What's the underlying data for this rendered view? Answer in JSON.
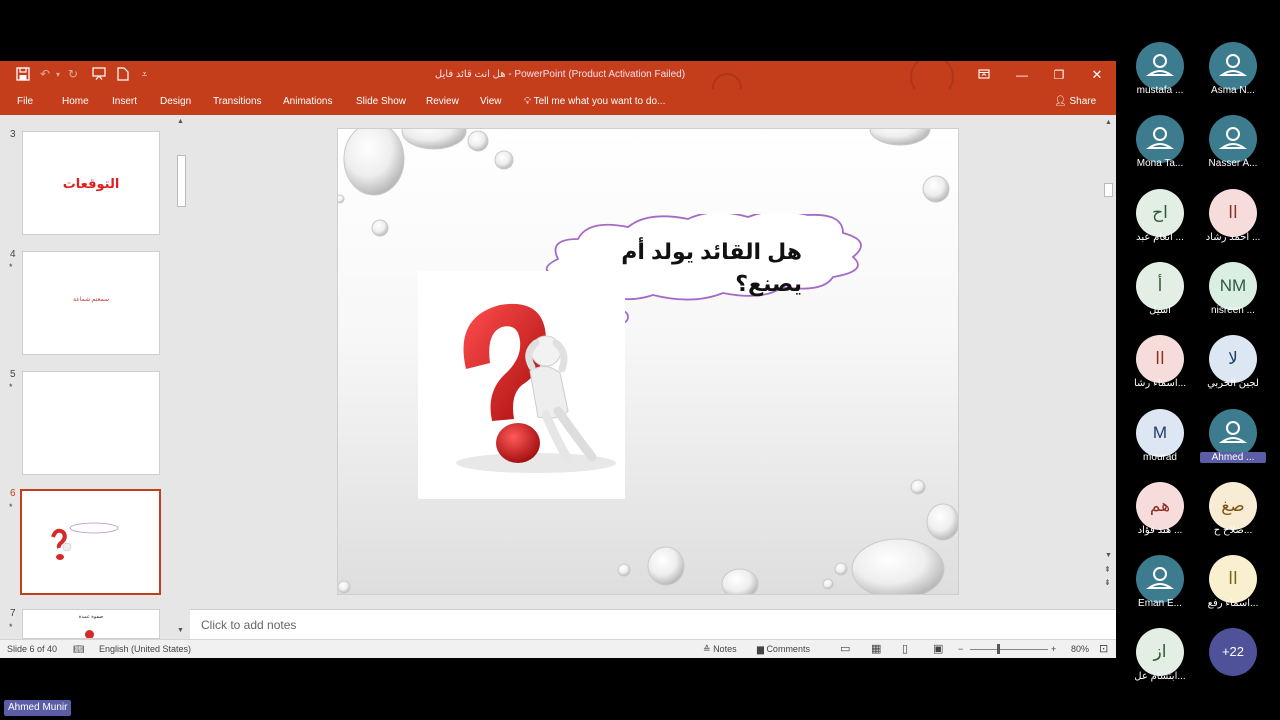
{
  "window": {
    "title": "هل انت قائد فايل - PowerPoint (Product Activation Failed)"
  },
  "ribbon": {
    "tabs": [
      "File",
      "Home",
      "Insert",
      "Design",
      "Transitions",
      "Animations",
      "Slide Show",
      "Review",
      "View"
    ],
    "tell_me": "Tell me what you want to do...",
    "share": "Share"
  },
  "thumbnails": [
    {
      "num": "3",
      "star": "",
      "text": "التوقعات"
    },
    {
      "num": "4",
      "star": "*",
      "text": "سمعتم شماعة"
    },
    {
      "num": "5",
      "star": "*",
      "text": ""
    },
    {
      "num": "6",
      "star": "*",
      "text": ""
    },
    {
      "num": "7",
      "star": "*",
      "text": "صفوة عمدة"
    }
  ],
  "slide": {
    "bubble_line1": "هل القائد يولد أم",
    "bubble_line2": "يصنع؟"
  },
  "notes_placeholder": "Click to add notes",
  "status": {
    "slide_info": "Slide 6 of 40",
    "language": "English (United States)",
    "notes": "Notes",
    "comments": "Comments",
    "zoom": "80%"
  },
  "participants": [
    {
      "initials": "",
      "name": "mustafa ...",
      "bg": "#3d7c8e",
      "fg": "#ffffff",
      "type": "person"
    },
    {
      "initials": "",
      "name": "Asma N...",
      "bg": "#3d7c8e",
      "fg": "#ffffff",
      "type": "person"
    },
    {
      "initials": "",
      "name": "Mona Ta...",
      "bg": "#3d7c8e",
      "fg": "#ffffff",
      "type": "person"
    },
    {
      "initials": "",
      "name": "Nasser A...",
      "bg": "#3d7c8e",
      "fg": "#ffffff",
      "type": "person"
    },
    {
      "initials": "اح",
      "name": "انعام عبد ...",
      "bg": "#e3efe4",
      "fg": "#2e5a32",
      "type": "initials"
    },
    {
      "initials": "اا",
      "name": "احمد رشاد ...",
      "bg": "#f6dddb",
      "fg": "#8f2f24",
      "type": "initials"
    },
    {
      "initials": "أ",
      "name": "اسيل",
      "bg": "#e3efe4",
      "fg": "#2e5a32",
      "type": "initials"
    },
    {
      "initials": "NM",
      "name": "nisreen ...",
      "bg": "#dbeee2",
      "fg": "#2b5b3d",
      "type": "initials"
    },
    {
      "initials": "اا",
      "name": "اسماء رشا...",
      "bg": "#f6dddb",
      "fg": "#8f2f24",
      "type": "initials"
    },
    {
      "initials": "لا",
      "name": "لجين الحربي",
      "bg": "#dde6f3",
      "fg": "#1f3d6b",
      "type": "initials"
    },
    {
      "initials": "M",
      "name": "mourad",
      "bg": "#dde6f3",
      "fg": "#1f3d6b",
      "type": "initials"
    },
    {
      "initials": "",
      "name": "Ahmed ...",
      "bg": "#3d7c8e",
      "fg": "#ffffff",
      "type": "person"
    },
    {
      "initials": "هم",
      "name": "هند فؤاد ...",
      "bg": "#f6dddb",
      "fg": "#8f2f24",
      "type": "initials"
    },
    {
      "initials": "صغ",
      "name": "صلاح ح...",
      "bg": "#f8ecd4",
      "fg": "#7a5614",
      "type": "initials"
    },
    {
      "initials": "",
      "name": "Eman E...",
      "bg": "#3d7c8e",
      "fg": "#ffffff",
      "type": "person"
    },
    {
      "initials": "اا",
      "name": "اسماء رفع...",
      "bg": "#f8f0cf",
      "fg": "#7a5f0f",
      "type": "initials"
    },
    {
      "initials": "از",
      "name": "ابتسام عل...",
      "bg": "#e3efe4",
      "fg": "#2e5a32",
      "type": "initials"
    },
    {
      "initials": "+22",
      "name": "",
      "bg": "#4f5199",
      "fg": "#ffffff",
      "type": "more"
    }
  ],
  "presenter_label": "Ahmed Munir",
  "colors": {
    "ppt_accent": "#c43e1c",
    "participant_avatar": "#3d7c8e",
    "highlight": "#5b5ea6"
  }
}
